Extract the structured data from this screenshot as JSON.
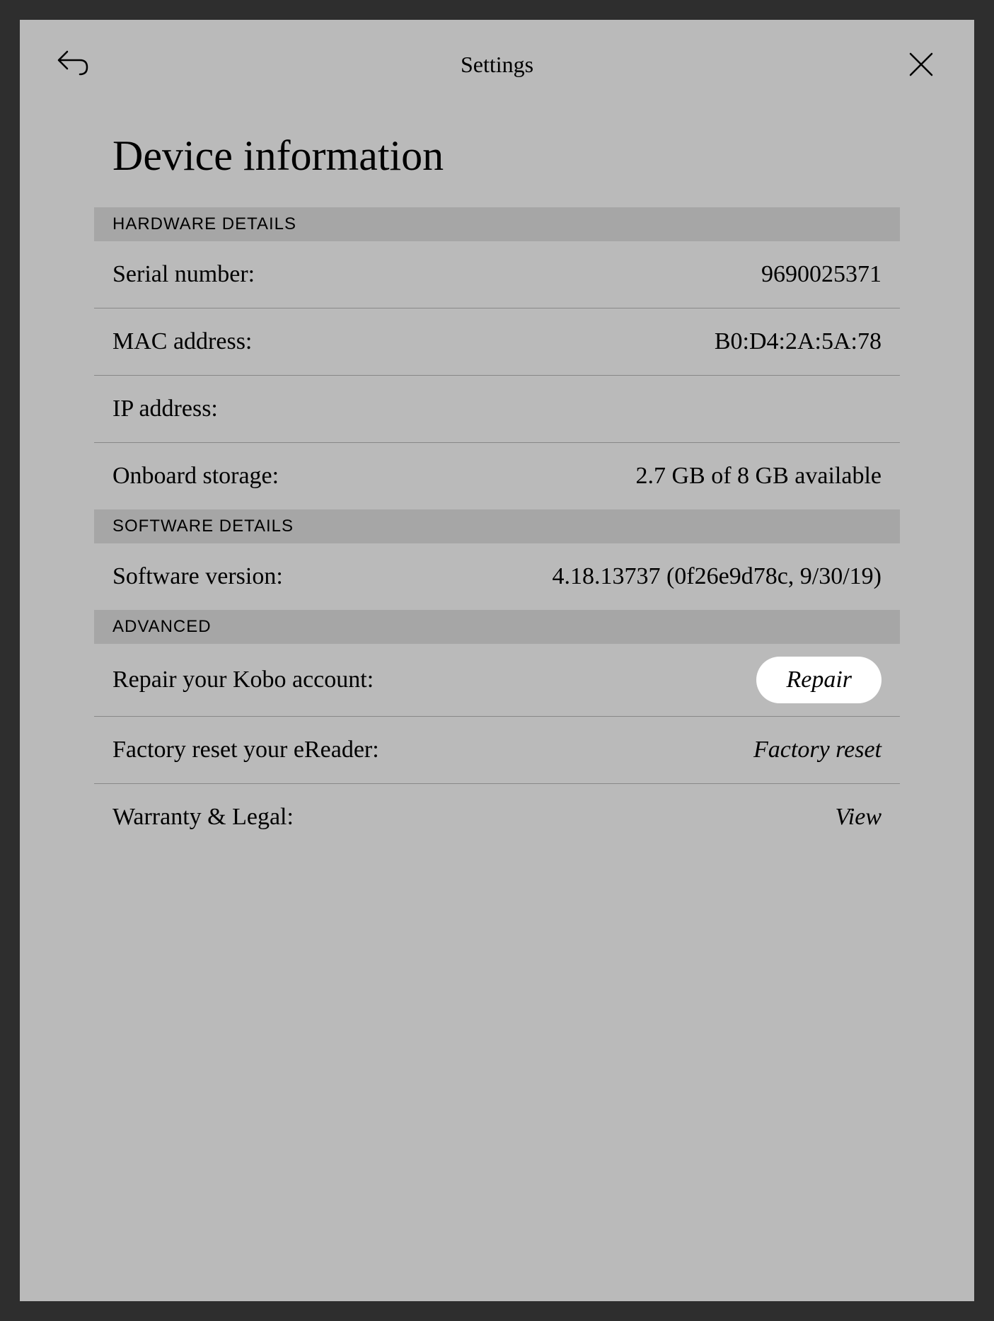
{
  "header": {
    "title": "Settings"
  },
  "page": {
    "title": "Device information"
  },
  "sections": {
    "hardware": {
      "header": "HARDWARE DETAILS",
      "serial_label": "Serial number:",
      "serial_value": "9690025371",
      "mac_label": "MAC address:",
      "mac_value": "B0:D4:2A:5A:78",
      "ip_label": "IP address:",
      "ip_value": "",
      "storage_label": "Onboard storage:",
      "storage_value": "2.7 GB of 8 GB available"
    },
    "software": {
      "header": "SOFTWARE DETAILS",
      "version_label": "Software version:",
      "version_value": "4.18.13737 (0f26e9d78c, 9/30/19)"
    },
    "advanced": {
      "header": "ADVANCED",
      "repair_label": "Repair your Kobo account:",
      "repair_action": "Repair",
      "reset_label": "Factory reset your eReader:",
      "reset_action": "Factory reset",
      "warranty_label": "Warranty & Legal:",
      "warranty_action": "View"
    }
  }
}
